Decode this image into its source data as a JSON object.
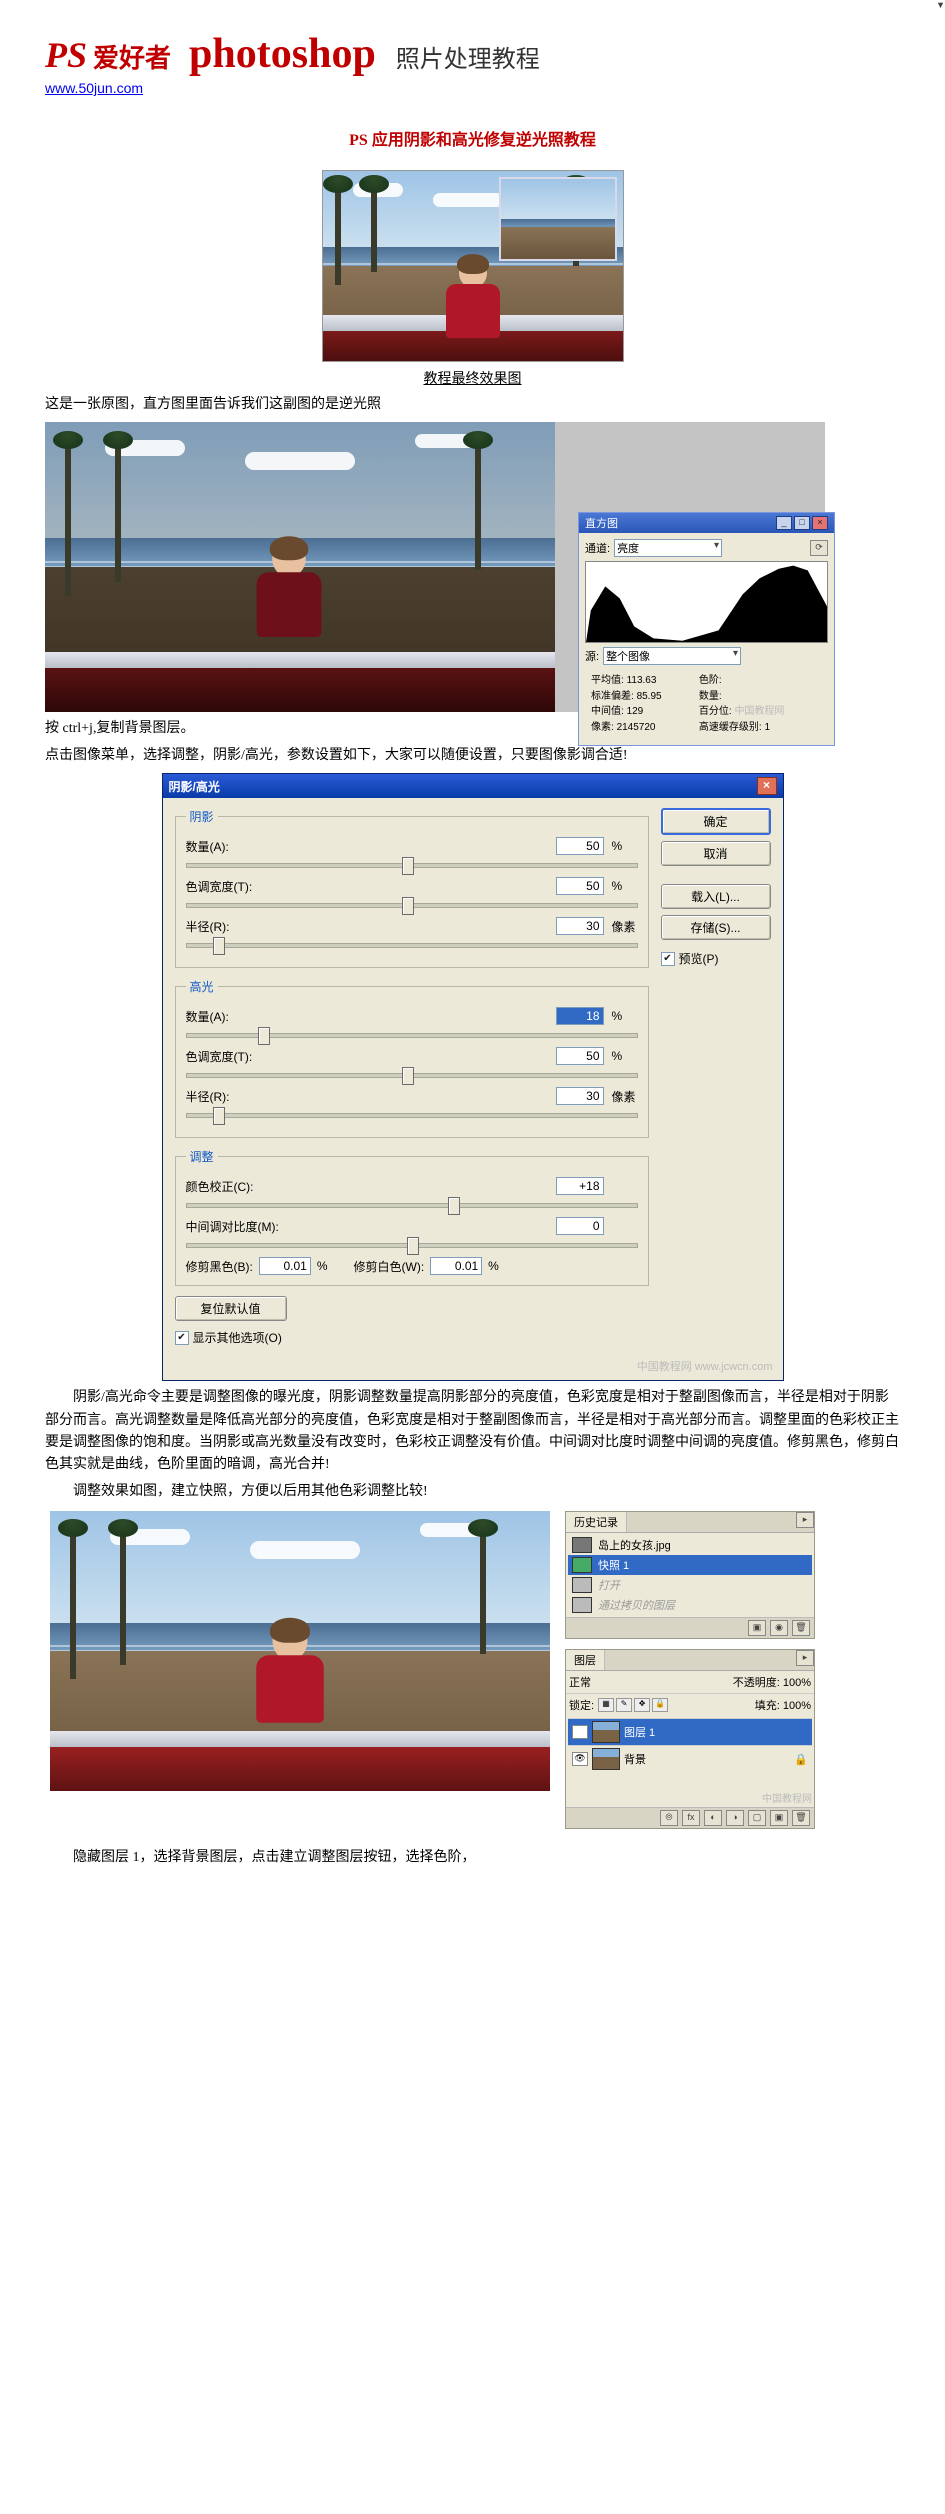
{
  "header": {
    "logo_ps": "PS",
    "logo_cn": "爱好者",
    "logo_word": "photoshop",
    "subtitle": "照片处理教程",
    "url": "www.50jun.com"
  },
  "title": "PS 应用阴影和高光修复逆光照教程",
  "caption_final": "教程最终效果图",
  "p1": "这是一张原图，直方图里面告诉我们这副图的是逆光照",
  "p2": "按 ctrl+j,复制背景图层。",
  "p3": "点击图像菜单，选择调整，阴影/高光，参数设置如下，大家可以随便设置，只要图像影调合适!",
  "p4": "阴影/高光命令主要是调整图像的曝光度，阴影调整数量提高阴影部分的亮度值，色彩宽度是相对于整副图像而言，半径是相对于阴影部分而言。高光调整数量是降低高光部分的亮度值，色彩宽度是相对于整副图像而言，半径是相对于高光部分而言。调整里面的色彩校正主要是调整图像的饱和度。当阴影或高光数量没有改变时，色彩校正调整没有价值。中间调对比度时调整中间调的亮度值。修剪黑色，修剪白色其实就是曲线，色阶里面的暗调，高光合并!",
  "p5": "调整效果如图，建立快照，方便以后用其他色彩调整比较!",
  "p6": "隐藏图层 1，选择背景图层，点击建立调整图层按钮，选择色阶，",
  "histogram_panel": {
    "title": "直方图",
    "channel_label": "通道:",
    "channel_value": "亮度",
    "source_label": "源:",
    "source_value": "整个图像",
    "stats": {
      "mean_label": "平均值:",
      "mean": "113.63",
      "std_label": "标准偏差:",
      "std": "85.95",
      "median_label": "中间值:",
      "median": "129",
      "pixels_label": "像素:",
      "pixels": "2145720",
      "level_label": "色阶:",
      "count_label": "数量:",
      "percent_label": "百分位:",
      "cache_label": "高速缓存级别:",
      "cache": "1"
    }
  },
  "dialog": {
    "title": "阴影/高光",
    "btn_ok": "确定",
    "btn_cancel": "取消",
    "btn_load": "载入(L)...",
    "btn_save": "存储(S)...",
    "chk_preview": "预览(P)",
    "grp_shadow": "阴影",
    "grp_highlight": "高光",
    "grp_adjust": "调整",
    "lbl_amount": "数量(A):",
    "lbl_amount2": "数量(A):",
    "lbl_tonewidth": "色调宽度(T):",
    "lbl_radius": "半径(R):",
    "lbl_colorcorrect": "颜色校正(C):",
    "lbl_midtone": "中间调对比度(M):",
    "lbl_clip_black": "修剪黑色(B):",
    "lbl_clip_white": "修剪白色(W):",
    "btn_reset": "复位默认值",
    "chk_showmore": "显示其他选项(O)",
    "unit_percent": "%",
    "unit_px": "像素",
    "val_shadow_amount": "50",
    "val_shadow_tone": "50",
    "val_shadow_radius": "30",
    "val_high_amount": "18",
    "val_high_tone": "50",
    "val_high_radius": "30",
    "val_colorcorrect": "+18",
    "val_midtone": "0",
    "val_clip_black": "0.01",
    "val_clip_white": "0.01",
    "watermark": "中国教程网  www.jcwcn.com"
  },
  "history_panel": {
    "tab": "历史记录",
    "doc_name": "岛上的女孩.jpg",
    "snapshot": "快照 1",
    "step_open": "打开",
    "step_dup": "通过拷贝的图层"
  },
  "layers_panel": {
    "tab": "图层",
    "mode_label": "正常",
    "opacity_label": "不透明度:",
    "opacity_value": "100%",
    "lock_label": "锁定:",
    "fill_label": "填充:",
    "fill_value": "100%",
    "layer1": "图层 1",
    "background": "背景",
    "watermark": "中国教程网"
  }
}
